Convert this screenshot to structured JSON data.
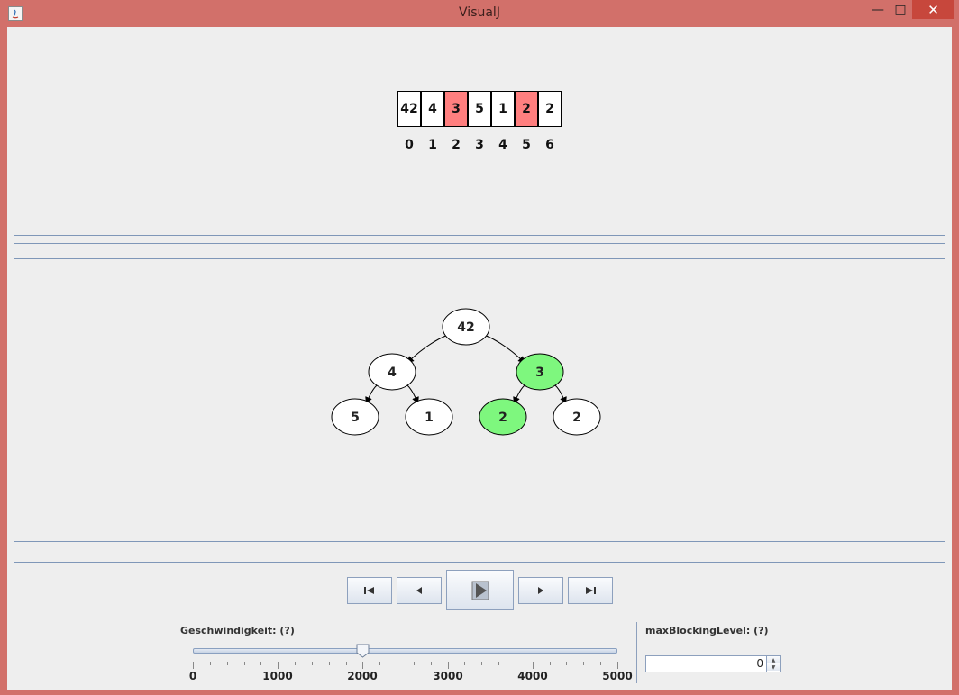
{
  "window": {
    "title": "VisualJ"
  },
  "array": {
    "cells": [
      {
        "value": "42",
        "index": "0",
        "highlighted": false
      },
      {
        "value": "4",
        "index": "1",
        "highlighted": false
      },
      {
        "value": "3",
        "index": "2",
        "highlighted": true
      },
      {
        "value": "5",
        "index": "3",
        "highlighted": false
      },
      {
        "value": "1",
        "index": "4",
        "highlighted": false
      },
      {
        "value": "2",
        "index": "5",
        "highlighted": true
      },
      {
        "value": "2",
        "index": "6",
        "highlighted": false
      }
    ],
    "highlight_color": "#ff7f7f"
  },
  "tree": {
    "nodes": [
      {
        "id": "n0",
        "value": "42",
        "highlighted": false
      },
      {
        "id": "n1",
        "value": "4",
        "highlighted": false
      },
      {
        "id": "n2",
        "value": "3",
        "highlighted": true
      },
      {
        "id": "n3",
        "value": "5",
        "highlighted": false
      },
      {
        "id": "n4",
        "value": "1",
        "highlighted": false
      },
      {
        "id": "n5",
        "value": "2",
        "highlighted": true
      },
      {
        "id": "n6",
        "value": "2",
        "highlighted": false
      }
    ],
    "edges": [
      [
        "n0",
        "n1"
      ],
      [
        "n0",
        "n2"
      ],
      [
        "n1",
        "n3"
      ],
      [
        "n1",
        "n4"
      ],
      [
        "n2",
        "n5"
      ],
      [
        "n2",
        "n6"
      ]
    ],
    "highlight_color": "#7ef77e"
  },
  "controls": {
    "buttons": [
      {
        "name": "first-step-button",
        "icon": "skip-to-start-icon"
      },
      {
        "name": "step-back-button",
        "icon": "step-back-icon"
      },
      {
        "name": "play-button",
        "icon": "play-icon"
      },
      {
        "name": "step-forward-button",
        "icon": "step-forward-icon"
      },
      {
        "name": "last-step-button",
        "icon": "skip-to-end-icon"
      }
    ]
  },
  "speed": {
    "label": "Geschwindigkeit: (?)",
    "value": 2000,
    "min": 0,
    "max": 5000,
    "tick_labels": [
      "0",
      "1000",
      "2000",
      "3000",
      "4000",
      "5000"
    ]
  },
  "blocking": {
    "label": "maxBlockingLevel: (?)",
    "value": "0"
  }
}
